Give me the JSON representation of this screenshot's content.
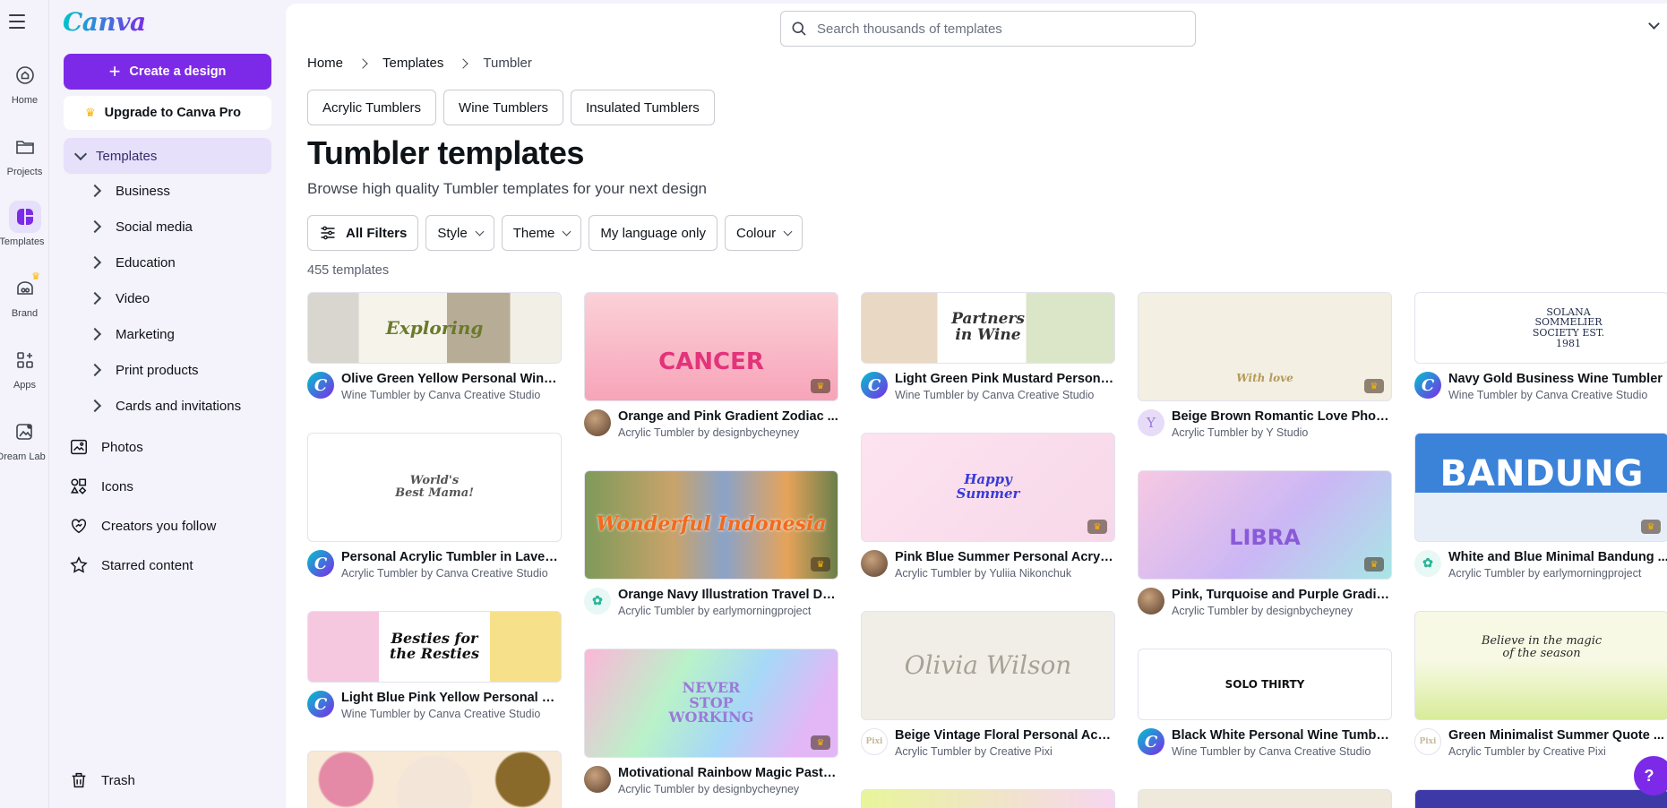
{
  "rail": {
    "items": [
      {
        "label": "Home",
        "icon": "home-icon"
      },
      {
        "label": "Projects",
        "icon": "folder-icon"
      },
      {
        "label": "Templates",
        "icon": "templates-icon"
      },
      {
        "label": "Brand",
        "icon": "brand-icon"
      },
      {
        "label": "Apps",
        "icon": "apps-icon"
      },
      {
        "label": "Dream Lab",
        "icon": "dream-lab-icon"
      }
    ]
  },
  "sidebar": {
    "logo": "Canva",
    "create_label": "Create a design",
    "upgrade_label": "Upgrade to Canva Pro",
    "templates_label": "Templates",
    "categories": [
      "Business",
      "Social media",
      "Education",
      "Video",
      "Marketing",
      "Print products",
      "Cards and invitations"
    ],
    "links": [
      "Photos",
      "Icons",
      "Creators you follow",
      "Starred content"
    ],
    "trash_label": "Trash"
  },
  "search": {
    "placeholder": "Search thousands of templates"
  },
  "breadcrumb": [
    "Home",
    "Templates",
    "Tumbler"
  ],
  "chips": [
    "Acrylic Tumblers",
    "Wine Tumblers",
    "Insulated Tumblers"
  ],
  "page": {
    "title": "Tumbler templates",
    "subtitle": "Browse high quality Tumbler templates for your next design",
    "count": "455 templates"
  },
  "filters": [
    "All Filters",
    "Style",
    "Theme",
    "My language only",
    "Colour"
  ],
  "colors": {
    "accent": "#7d2ae8",
    "accent_soft": "#e6e0fb",
    "crown": "#f7b500"
  },
  "templates": [
    {
      "title": "Olive Green Yellow Personal Wine ...",
      "author": "Wine Tumbler by Canva Creative Studio",
      "thumb_text": "Exploring"
    },
    {
      "title": "Personal Acrylic Tumbler in Laven...",
      "author": "Acrylic Tumbler by Canva Creative Studio",
      "thumb_text": "World's Best Mama!"
    },
    {
      "title": "Light Blue Pink Yellow Personal Wi...",
      "author": "Wine Tumbler by Canva Creative Studio",
      "thumb_text": "Besties for the Resties"
    },
    {
      "title": "Orange and Pink Gradient Zodiac ...",
      "author": "Acrylic Tumbler by designbycheyney",
      "thumb_text": "CANCER"
    },
    {
      "title": "Orange Navy Illustration Travel De...",
      "author": "Acrylic Tumbler by earlymorningproject",
      "thumb_text": "Wonderful Indonesia"
    },
    {
      "title": "Motivational Rainbow Magic Paste...",
      "author": "Acrylic Tumbler by designbycheyney",
      "thumb_text": "NEVER STOP WORKING"
    },
    {
      "title": "Light Green Pink Mustard Persona...",
      "author": "Wine Tumbler by Canva Creative Studio",
      "thumb_text": "Partners in Wine"
    },
    {
      "title": "Pink Blue Summer Personal Acryli...",
      "author": "Acrylic Tumbler by Yuliia Nikonchuk",
      "thumb_text": "Happy Summer"
    },
    {
      "title": "Beige Vintage Floral Personal Acry...",
      "author": "Acrylic Tumbler by Creative Pixi",
      "thumb_text": "Olivia Wilson"
    },
    {
      "title": "Beige Brown Romantic Love Photo...",
      "author": "Acrylic Tumbler by Y Studio",
      "thumb_text": "With love"
    },
    {
      "title": "Pink, Turquoise and Purple Gradie...",
      "author": "Acrylic Tumbler by designbycheyney",
      "thumb_text": "LIBRA"
    },
    {
      "title": "Black White Personal Wine Tumbler",
      "author": "Wine Tumbler by Canva Creative Studio",
      "thumb_text": "SOLO THIRTY"
    },
    {
      "title": "Navy Gold Business Wine Tumbler",
      "author": "Wine Tumbler by Canva Creative Studio",
      "thumb_text": "SOLANA SOMMELIER SOCIETY EST. 1981"
    },
    {
      "title": "White and Blue Minimal Bandung ...",
      "author": "Acrylic Tumbler by earlymorningproject",
      "thumb_text": "BANDUNG"
    },
    {
      "title": "Green Minimalist Summer Quote ...",
      "author": "Acrylic Tumbler by Creative Pixi",
      "thumb_text": "Believe in the magic of the season"
    }
  ]
}
